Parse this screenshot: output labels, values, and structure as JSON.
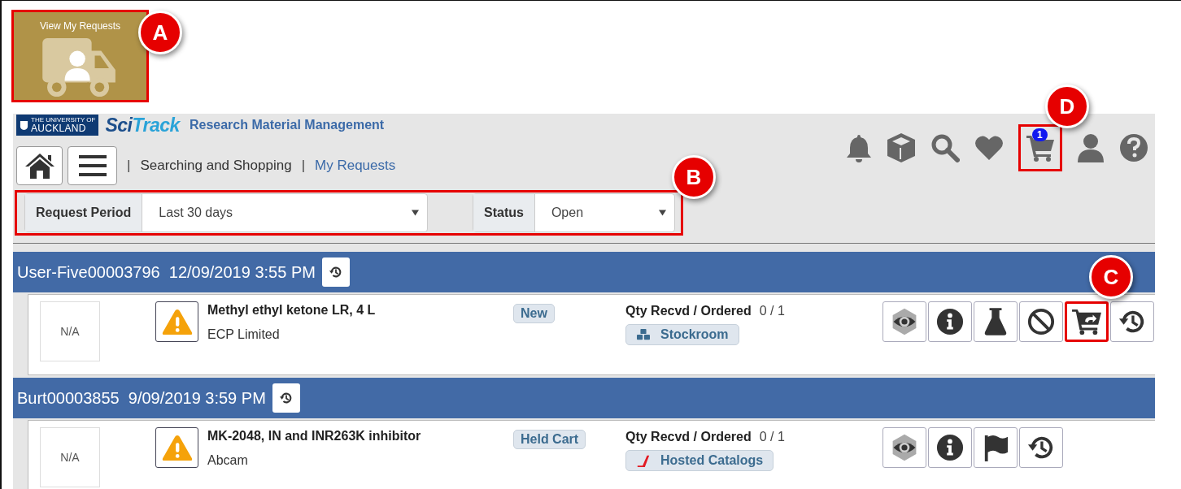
{
  "tile": {
    "label": "View My Requests",
    "callout": "A"
  },
  "brand": {
    "university_top": "THE UNIVERSITY OF",
    "university_name": "AUCKLAND",
    "product_first": "Sci",
    "product_second": "Track",
    "subtitle": "Research Material Management"
  },
  "toolbar_icons": [
    {
      "kind": "bell"
    },
    {
      "kind": "cube"
    },
    {
      "kind": "search"
    },
    {
      "kind": "heart"
    },
    {
      "kind": "cart",
      "badge": "1",
      "callout": "D"
    },
    {
      "kind": "user"
    },
    {
      "kind": "help"
    }
  ],
  "breadcrumbs": [
    {
      "separator": "|",
      "label": "Searching and Shopping",
      "kind": "text"
    },
    {
      "separator": "|",
      "label": "My Requests",
      "kind": "link"
    }
  ],
  "filters": {
    "callout": "B",
    "items": [
      {
        "label": "Request Period",
        "value": "Last 30 days"
      },
      {
        "label": "Status",
        "value": "Open"
      }
    ]
  },
  "requests": [
    {
      "requester": "User-Five00003796",
      "date": "12/09/2019 3:55 PM",
      "item": {
        "image": "N/A",
        "name": "Methyl ethyl ketone LR, 4 L",
        "supplier": "ECP Limited",
        "status": "New",
        "qty_label": "Qty Recvd / Ordered",
        "qty": "0 / 1",
        "source": {
          "kind": "stockroom",
          "label": "Stockroom"
        },
        "actions": [
          {
            "kind": "eye"
          },
          {
            "kind": "info"
          },
          {
            "kind": "flask"
          },
          {
            "kind": "ban"
          },
          {
            "kind": "cart-return",
            "callout": "C"
          },
          {
            "kind": "history"
          }
        ]
      }
    },
    {
      "requester": "Burt00003855",
      "date": "9/09/2019 3:59 PM",
      "item": {
        "image": "N/A",
        "name": "MK-2048, IN and INR263K inhibitor",
        "supplier": "Abcam",
        "status": "Held Cart",
        "qty_label": "Qty Recvd / Ordered",
        "qty": "0 / 1",
        "source": {
          "kind": "catalog",
          "label": "Hosted Catalogs"
        },
        "actions": [
          {
            "kind": "eye"
          },
          {
            "kind": "info"
          },
          {
            "kind": "flag"
          },
          {
            "kind": "history"
          }
        ]
      }
    }
  ]
}
